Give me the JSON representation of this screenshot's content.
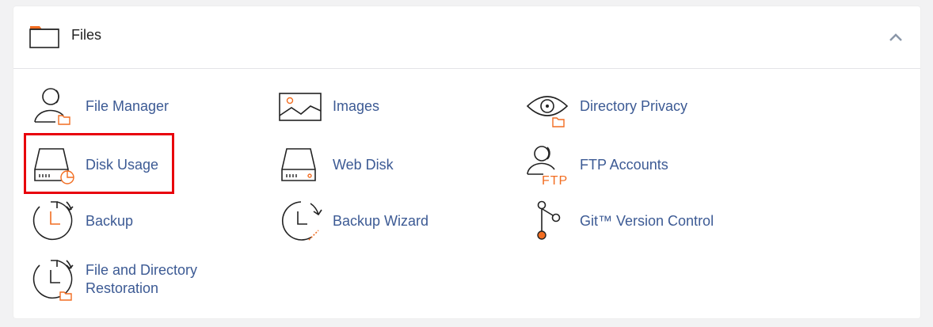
{
  "section": {
    "title": "Files",
    "icon": "folder-icon",
    "collapse_icon": "chevron-up-icon"
  },
  "items": [
    {
      "label": "File Manager",
      "icon": "file-manager-icon"
    },
    {
      "label": "Images",
      "icon": "images-icon"
    },
    {
      "label": "Directory Privacy",
      "icon": "directory-privacy-icon"
    },
    {
      "label": "Disk Usage",
      "icon": "disk-usage-icon"
    },
    {
      "label": "Web Disk",
      "icon": "web-disk-icon"
    },
    {
      "label": "FTP Accounts",
      "icon": "ftp-accounts-icon"
    },
    {
      "label": "Backup",
      "icon": "backup-icon"
    },
    {
      "label": "Backup Wizard",
      "icon": "backup-wizard-icon"
    },
    {
      "label": "Git™ Version Control",
      "icon": "git-icon"
    },
    {
      "label": "File and Directory Restoration",
      "icon": "file-restoration-icon"
    }
  ],
  "ftp_icon_text": "FTP",
  "colors": {
    "accent": "#f26d21",
    "link": "#3c5a94",
    "highlight": "#e8000b"
  }
}
